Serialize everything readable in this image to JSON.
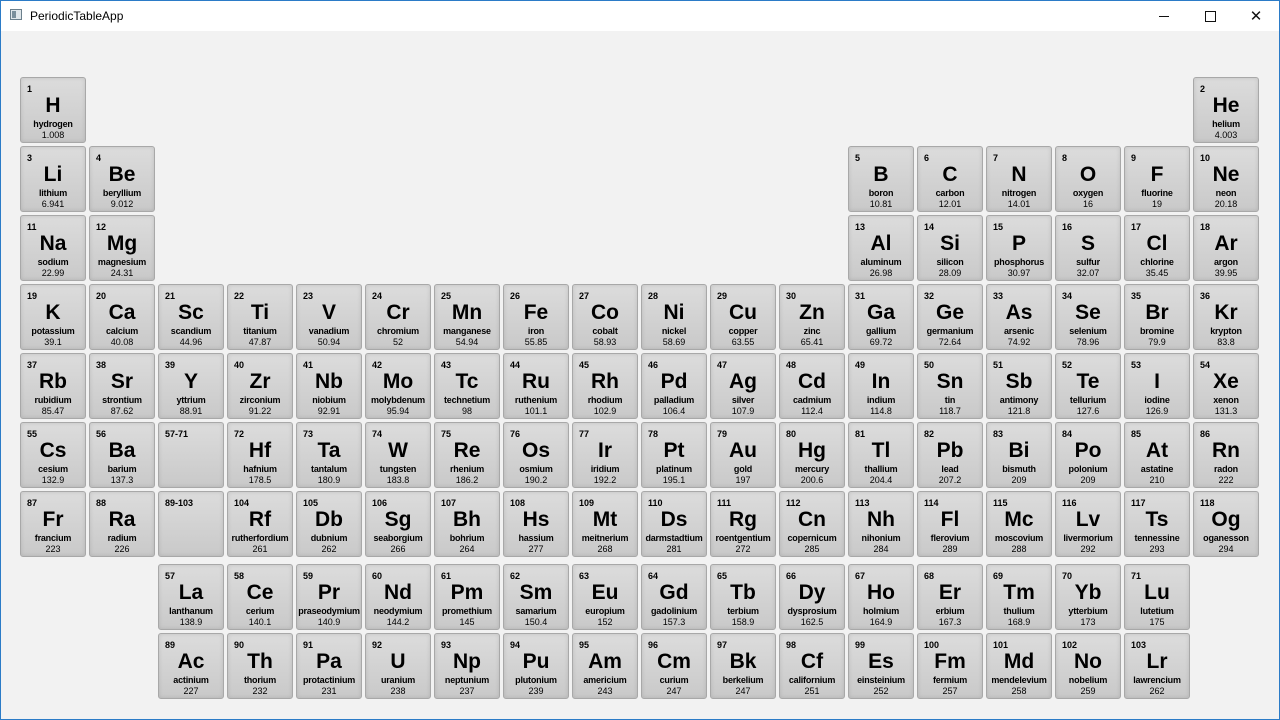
{
  "window": {
    "title": "PeriodicTableApp",
    "controls": {
      "minimize": "–",
      "maximize": "□",
      "close": "✕"
    }
  },
  "elements": [
    {
      "number": "1",
      "symbol": "H",
      "name": "hydrogen",
      "weight": "1.008",
      "period": 1,
      "group": 1
    },
    {
      "number": "2",
      "symbol": "He",
      "name": "helium",
      "weight": "4.003",
      "period": 1,
      "group": 18
    },
    {
      "number": "3",
      "symbol": "Li",
      "name": "lithium",
      "weight": "6.941",
      "period": 2,
      "group": 1
    },
    {
      "number": "4",
      "symbol": "Be",
      "name": "beryllium",
      "weight": "9.012",
      "period": 2,
      "group": 2
    },
    {
      "number": "5",
      "symbol": "B",
      "name": "boron",
      "weight": "10.81",
      "period": 2,
      "group": 13
    },
    {
      "number": "6",
      "symbol": "C",
      "name": "carbon",
      "weight": "12.01",
      "period": 2,
      "group": 14
    },
    {
      "number": "7",
      "symbol": "N",
      "name": "nitrogen",
      "weight": "14.01",
      "period": 2,
      "group": 15
    },
    {
      "number": "8",
      "symbol": "O",
      "name": "oxygen",
      "weight": "16",
      "period": 2,
      "group": 16
    },
    {
      "number": "9",
      "symbol": "F",
      "name": "fluorine",
      "weight": "19",
      "period": 2,
      "group": 17
    },
    {
      "number": "10",
      "symbol": "Ne",
      "name": "neon",
      "weight": "20.18",
      "period": 2,
      "group": 18
    },
    {
      "number": "11",
      "symbol": "Na",
      "name": "sodium",
      "weight": "22.99",
      "period": 3,
      "group": 1
    },
    {
      "number": "12",
      "symbol": "Mg",
      "name": "magnesium",
      "weight": "24.31",
      "period": 3,
      "group": 2
    },
    {
      "number": "13",
      "symbol": "Al",
      "name": "aluminum",
      "weight": "26.98",
      "period": 3,
      "group": 13
    },
    {
      "number": "14",
      "symbol": "Si",
      "name": "silicon",
      "weight": "28.09",
      "period": 3,
      "group": 14
    },
    {
      "number": "15",
      "symbol": "P",
      "name": "phosphorus",
      "weight": "30.97",
      "period": 3,
      "group": 15
    },
    {
      "number": "16",
      "symbol": "S",
      "name": "sulfur",
      "weight": "32.07",
      "period": 3,
      "group": 16
    },
    {
      "number": "17",
      "symbol": "Cl",
      "name": "chlorine",
      "weight": "35.45",
      "period": 3,
      "group": 17
    },
    {
      "number": "18",
      "symbol": "Ar",
      "name": "argon",
      "weight": "39.95",
      "period": 3,
      "group": 18
    },
    {
      "number": "19",
      "symbol": "K",
      "name": "potassium",
      "weight": "39.1",
      "period": 4,
      "group": 1
    },
    {
      "number": "20",
      "symbol": "Ca",
      "name": "calcium",
      "weight": "40.08",
      "period": 4,
      "group": 2
    },
    {
      "number": "21",
      "symbol": "Sc",
      "name": "scandium",
      "weight": "44.96",
      "period": 4,
      "group": 3
    },
    {
      "number": "22",
      "symbol": "Ti",
      "name": "titanium",
      "weight": "47.87",
      "period": 4,
      "group": 4
    },
    {
      "number": "23",
      "symbol": "V",
      "name": "vanadium",
      "weight": "50.94",
      "period": 4,
      "group": 5
    },
    {
      "number": "24",
      "symbol": "Cr",
      "name": "chromium",
      "weight": "52",
      "period": 4,
      "group": 6
    },
    {
      "number": "25",
      "symbol": "Mn",
      "name": "manganese",
      "weight": "54.94",
      "period": 4,
      "group": 7
    },
    {
      "number": "26",
      "symbol": "Fe",
      "name": "iron",
      "weight": "55.85",
      "period": 4,
      "group": 8
    },
    {
      "number": "27",
      "symbol": "Co",
      "name": "cobalt",
      "weight": "58.93",
      "period": 4,
      "group": 9
    },
    {
      "number": "28",
      "symbol": "Ni",
      "name": "nickel",
      "weight": "58.69",
      "period": 4,
      "group": 10
    },
    {
      "number": "29",
      "symbol": "Cu",
      "name": "copper",
      "weight": "63.55",
      "period": 4,
      "group": 11
    },
    {
      "number": "30",
      "symbol": "Zn",
      "name": "zinc",
      "weight": "65.41",
      "period": 4,
      "group": 12
    },
    {
      "number": "31",
      "symbol": "Ga",
      "name": "gallium",
      "weight": "69.72",
      "period": 4,
      "group": 13
    },
    {
      "number": "32",
      "symbol": "Ge",
      "name": "germanium",
      "weight": "72.64",
      "period": 4,
      "group": 14
    },
    {
      "number": "33",
      "symbol": "As",
      "name": "arsenic",
      "weight": "74.92",
      "period": 4,
      "group": 15
    },
    {
      "number": "34",
      "symbol": "Se",
      "name": "selenium",
      "weight": "78.96",
      "period": 4,
      "group": 16
    },
    {
      "number": "35",
      "symbol": "Br",
      "name": "bromine",
      "weight": "79.9",
      "period": 4,
      "group": 17
    },
    {
      "number": "36",
      "symbol": "Kr",
      "name": "krypton",
      "weight": "83.8",
      "period": 4,
      "group": 18
    },
    {
      "number": "37",
      "symbol": "Rb",
      "name": "rubidium",
      "weight": "85.47",
      "period": 5,
      "group": 1
    },
    {
      "number": "38",
      "symbol": "Sr",
      "name": "strontium",
      "weight": "87.62",
      "period": 5,
      "group": 2
    },
    {
      "number": "39",
      "symbol": "Y",
      "name": "yttrium",
      "weight": "88.91",
      "period": 5,
      "group": 3
    },
    {
      "number": "40",
      "symbol": "Zr",
      "name": "zirconium",
      "weight": "91.22",
      "period": 5,
      "group": 4
    },
    {
      "number": "41",
      "symbol": "Nb",
      "name": "niobium",
      "weight": "92.91",
      "period": 5,
      "group": 5
    },
    {
      "number": "42",
      "symbol": "Mo",
      "name": "molybdenum",
      "weight": "95.94",
      "period": 5,
      "group": 6
    },
    {
      "number": "43",
      "symbol": "Tc",
      "name": "technetium",
      "weight": "98",
      "period": 5,
      "group": 7
    },
    {
      "number": "44",
      "symbol": "Ru",
      "name": "ruthenium",
      "weight": "101.1",
      "period": 5,
      "group": 8
    },
    {
      "number": "45",
      "symbol": "Rh",
      "name": "rhodium",
      "weight": "102.9",
      "period": 5,
      "group": 9
    },
    {
      "number": "46",
      "symbol": "Pd",
      "name": "palladium",
      "weight": "106.4",
      "period": 5,
      "group": 10
    },
    {
      "number": "47",
      "symbol": "Ag",
      "name": "silver",
      "weight": "107.9",
      "period": 5,
      "group": 11
    },
    {
      "number": "48",
      "symbol": "Cd",
      "name": "cadmium",
      "weight": "112.4",
      "period": 5,
      "group": 12
    },
    {
      "number": "49",
      "symbol": "In",
      "name": "indium",
      "weight": "114.8",
      "period": 5,
      "group": 13
    },
    {
      "number": "50",
      "symbol": "Sn",
      "name": "tin",
      "weight": "118.7",
      "period": 5,
      "group": 14
    },
    {
      "number": "51",
      "symbol": "Sb",
      "name": "antimony",
      "weight": "121.8",
      "period": 5,
      "group": 15
    },
    {
      "number": "52",
      "symbol": "Te",
      "name": "tellurium",
      "weight": "127.6",
      "period": 5,
      "group": 16
    },
    {
      "number": "53",
      "symbol": "I",
      "name": "iodine",
      "weight": "126.9",
      "period": 5,
      "group": 17
    },
    {
      "number": "54",
      "symbol": "Xe",
      "name": "xenon",
      "weight": "131.3",
      "period": 5,
      "group": 18
    },
    {
      "number": "55",
      "symbol": "Cs",
      "name": "cesium",
      "weight": "132.9",
      "period": 6,
      "group": 1
    },
    {
      "number": "56",
      "symbol": "Ba",
      "name": "barium",
      "weight": "137.3",
      "period": 6,
      "group": 2
    },
    {
      "number": "57-71",
      "symbol": "",
      "name": "",
      "weight": "",
      "period": 6,
      "group": 3
    },
    {
      "number": "72",
      "symbol": "Hf",
      "name": "hafnium",
      "weight": "178.5",
      "period": 6,
      "group": 4
    },
    {
      "number": "73",
      "symbol": "Ta",
      "name": "tantalum",
      "weight": "180.9",
      "period": 6,
      "group": 5
    },
    {
      "number": "74",
      "symbol": "W",
      "name": "tungsten",
      "weight": "183.8",
      "period": 6,
      "group": 6
    },
    {
      "number": "75",
      "symbol": "Re",
      "name": "rhenium",
      "weight": "186.2",
      "period": 6,
      "group": 7
    },
    {
      "number": "76",
      "symbol": "Os",
      "name": "osmium",
      "weight": "190.2",
      "period": 6,
      "group": 8
    },
    {
      "number": "77",
      "symbol": "Ir",
      "name": "iridium",
      "weight": "192.2",
      "period": 6,
      "group": 9
    },
    {
      "number": "78",
      "symbol": "Pt",
      "name": "platinum",
      "weight": "195.1",
      "period": 6,
      "group": 10
    },
    {
      "number": "79",
      "symbol": "Au",
      "name": "gold",
      "weight": "197",
      "period": 6,
      "group": 11
    },
    {
      "number": "80",
      "symbol": "Hg",
      "name": "mercury",
      "weight": "200.6",
      "period": 6,
      "group": 12
    },
    {
      "number": "81",
      "symbol": "Tl",
      "name": "thallium",
      "weight": "204.4",
      "period": 6,
      "group": 13
    },
    {
      "number": "82",
      "symbol": "Pb",
      "name": "lead",
      "weight": "207.2",
      "period": 6,
      "group": 14
    },
    {
      "number": "83",
      "symbol": "Bi",
      "name": "bismuth",
      "weight": "209",
      "period": 6,
      "group": 15
    },
    {
      "number": "84",
      "symbol": "Po",
      "name": "polonium",
      "weight": "209",
      "period": 6,
      "group": 16
    },
    {
      "number": "85",
      "symbol": "At",
      "name": "astatine",
      "weight": "210",
      "period": 6,
      "group": 17
    },
    {
      "number": "86",
      "symbol": "Rn",
      "name": "radon",
      "weight": "222",
      "period": 6,
      "group": 18
    },
    {
      "number": "87",
      "symbol": "Fr",
      "name": "francium",
      "weight": "223",
      "period": 7,
      "group": 1
    },
    {
      "number": "88",
      "symbol": "Ra",
      "name": "radium",
      "weight": "226",
      "period": 7,
      "group": 2
    },
    {
      "number": "89-103",
      "symbol": "",
      "name": "",
      "weight": "",
      "period": 7,
      "group": 3
    },
    {
      "number": "104",
      "symbol": "Rf",
      "name": "rutherfordium",
      "weight": "261",
      "period": 7,
      "group": 4
    },
    {
      "number": "105",
      "symbol": "Db",
      "name": "dubnium",
      "weight": "262",
      "period": 7,
      "group": 5
    },
    {
      "number": "106",
      "symbol": "Sg",
      "name": "seaborgium",
      "weight": "266",
      "period": 7,
      "group": 6
    },
    {
      "number": "107",
      "symbol": "Bh",
      "name": "bohrium",
      "weight": "264",
      "period": 7,
      "group": 7
    },
    {
      "number": "108",
      "symbol": "Hs",
      "name": "hassium",
      "weight": "277",
      "period": 7,
      "group": 8
    },
    {
      "number": "109",
      "symbol": "Mt",
      "name": "meitnerium",
      "weight": "268",
      "period": 7,
      "group": 9
    },
    {
      "number": "110",
      "symbol": "Ds",
      "name": "darmstadtium",
      "weight": "281",
      "period": 7,
      "group": 10
    },
    {
      "number": "111",
      "symbol": "Rg",
      "name": "roentgentium",
      "weight": "272",
      "period": 7,
      "group": 11
    },
    {
      "number": "112",
      "symbol": "Cn",
      "name": "copernicum",
      "weight": "285",
      "period": 7,
      "group": 12
    },
    {
      "number": "113",
      "symbol": "Nh",
      "name": "nihonium",
      "weight": "284",
      "period": 7,
      "group": 13
    },
    {
      "number": "114",
      "symbol": "Fl",
      "name": "flerovium",
      "weight": "289",
      "period": 7,
      "group": 14
    },
    {
      "number": "115",
      "symbol": "Mc",
      "name": "moscovium",
      "weight": "288",
      "period": 7,
      "group": 15
    },
    {
      "number": "116",
      "symbol": "Lv",
      "name": "livermorium",
      "weight": "292",
      "period": 7,
      "group": 16
    },
    {
      "number": "117",
      "symbol": "Ts",
      "name": "tennessine",
      "weight": "293",
      "period": 7,
      "group": 17
    },
    {
      "number": "118",
      "symbol": "Og",
      "name": "oganesson",
      "weight": "294",
      "period": 7,
      "group": 18
    },
    {
      "number": "57",
      "symbol": "La",
      "name": "lanthanum",
      "weight": "138.9",
      "period": 9,
      "group": 3
    },
    {
      "number": "58",
      "symbol": "Ce",
      "name": "cerium",
      "weight": "140.1",
      "period": 9,
      "group": 4
    },
    {
      "number": "59",
      "symbol": "Pr",
      "name": "praseodymium",
      "weight": "140.9",
      "period": 9,
      "group": 5
    },
    {
      "number": "60",
      "symbol": "Nd",
      "name": "neodymium",
      "weight": "144.2",
      "period": 9,
      "group": 6
    },
    {
      "number": "61",
      "symbol": "Pm",
      "name": "promethium",
      "weight": "145",
      "period": 9,
      "group": 7
    },
    {
      "number": "62",
      "symbol": "Sm",
      "name": "samarium",
      "weight": "150.4",
      "period": 9,
      "group": 8
    },
    {
      "number": "63",
      "symbol": "Eu",
      "name": "europium",
      "weight": "152",
      "period": 9,
      "group": 9
    },
    {
      "number": "64",
      "symbol": "Gd",
      "name": "gadolinium",
      "weight": "157.3",
      "period": 9,
      "group": 10
    },
    {
      "number": "65",
      "symbol": "Tb",
      "name": "terbium",
      "weight": "158.9",
      "period": 9,
      "group": 11
    },
    {
      "number": "66",
      "symbol": "Dy",
      "name": "dysprosium",
      "weight": "162.5",
      "period": 9,
      "group": 12
    },
    {
      "number": "67",
      "symbol": "Ho",
      "name": "holmium",
      "weight": "164.9",
      "period": 9,
      "group": 13
    },
    {
      "number": "68",
      "symbol": "Er",
      "name": "erbium",
      "weight": "167.3",
      "period": 9,
      "group": 14
    },
    {
      "number": "69",
      "symbol": "Tm",
      "name": "thulium",
      "weight": "168.9",
      "period": 9,
      "group": 15
    },
    {
      "number": "70",
      "symbol": "Yb",
      "name": "ytterbium",
      "weight": "173",
      "period": 9,
      "group": 16
    },
    {
      "number": "71",
      "symbol": "Lu",
      "name": "lutetium",
      "weight": "175",
      "period": 9,
      "group": 17
    },
    {
      "number": "89",
      "symbol": "Ac",
      "name": "actinium",
      "weight": "227",
      "period": 10,
      "group": 3
    },
    {
      "number": "90",
      "symbol": "Th",
      "name": "thorium",
      "weight": "232",
      "period": 10,
      "group": 4
    },
    {
      "number": "91",
      "symbol": "Pa",
      "name": "protactinium",
      "weight": "231",
      "period": 10,
      "group": 5
    },
    {
      "number": "92",
      "symbol": "U",
      "name": "uranium",
      "weight": "238",
      "period": 10,
      "group": 6
    },
    {
      "number": "93",
      "symbol": "Np",
      "name": "neptunium",
      "weight": "237",
      "period": 10,
      "group": 7
    },
    {
      "number": "94",
      "symbol": "Pu",
      "name": "plutonium",
      "weight": "239",
      "period": 10,
      "group": 8
    },
    {
      "number": "95",
      "symbol": "Am",
      "name": "americium",
      "weight": "243",
      "period": 10,
      "group": 9
    },
    {
      "number": "96",
      "symbol": "Cm",
      "name": "curium",
      "weight": "247",
      "period": 10,
      "group": 10
    },
    {
      "number": "97",
      "symbol": "Bk",
      "name": "berkelium",
      "weight": "247",
      "period": 10,
      "group": 11
    },
    {
      "number": "98",
      "symbol": "Cf",
      "name": "californium",
      "weight": "251",
      "period": 10,
      "group": 12
    },
    {
      "number": "99",
      "symbol": "Es",
      "name": "einsteinium",
      "weight": "252",
      "period": 10,
      "group": 13
    },
    {
      "number": "100",
      "symbol": "Fm",
      "name": "fermium",
      "weight": "257",
      "period": 10,
      "group": 14
    },
    {
      "number": "101",
      "symbol": "Md",
      "name": "mendelevium",
      "weight": "258",
      "period": 10,
      "group": 15
    },
    {
      "number": "102",
      "symbol": "No",
      "name": "nobelium",
      "weight": "259",
      "period": 10,
      "group": 16
    },
    {
      "number": "103",
      "symbol": "Lr",
      "name": "lawrencium",
      "weight": "262",
      "period": 10,
      "group": 17
    }
  ]
}
